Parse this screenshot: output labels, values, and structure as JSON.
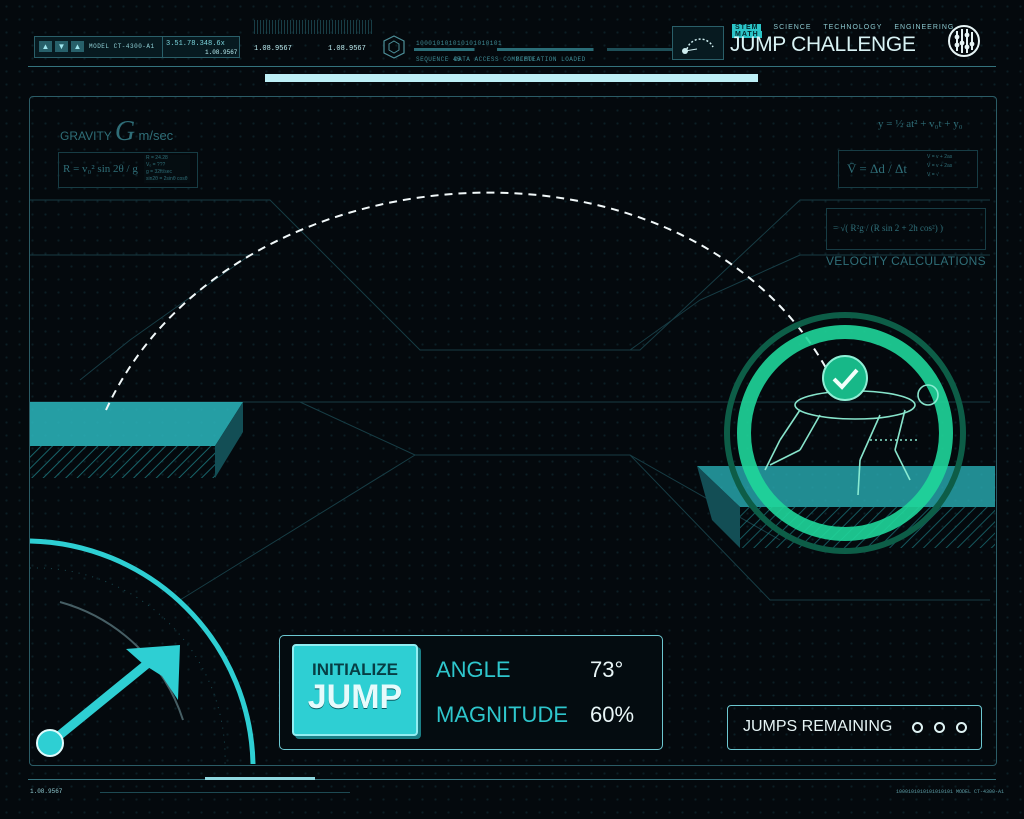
{
  "header": {
    "model_label": "MODEL CT-4300-A1",
    "readout_main": "3.51.78.348.6x",
    "readout_sub": "1.08.9567",
    "readout_a": "1.08.9567",
    "readout_b": "1.08.9567",
    "binary": "100010101010101010101",
    "sequence_label": "SEQUENCE 45",
    "data_label": "DATA ACCESS COMPLETE",
    "sim_label": "SIMULATION LOADED",
    "stem_tag": "STEM",
    "subjects": [
      "SCIENCE",
      "TECHNOLOGY",
      "ENGINEERING"
    ],
    "math_tag": "MATH",
    "title": "JUMP CHALLENGE"
  },
  "progress": {
    "fraction": 1.0
  },
  "formulas": {
    "gravity_label": "GRAVITY",
    "gravity_symbol": "G",
    "gravity_unit": "m/sec",
    "range_eq": "R = v₀² sin 2θ / g",
    "range_notes": [
      "R = 24.28",
      "Vₒ = ???",
      "g = 32ft/sec",
      "sin2θ = 2sinθ cosθ"
    ],
    "position_eq": "y = ½ at² + v₀t + y₀",
    "velocity_eq": "V̄ = Δd / Δt",
    "velocity_notes": [
      "V = v + 2as",
      "V = v + 2as",
      "V = √"
    ],
    "root_eq": "= √( R²g / (R sin 2 + 2h cos²) )",
    "velocity_title": "VELOCITY CALCULATIONS"
  },
  "controls": {
    "button_line1": "INITIALIZE",
    "button_line2": "JUMP",
    "angle_label": "ANGLE",
    "angle_value": "73°",
    "magnitude_label": "MAGNITUDE",
    "magnitude_value": "60%"
  },
  "jumps": {
    "label": "JUMPS REMAINING",
    "count": 3
  },
  "footer": {
    "left_readout": "1.08.9567",
    "right_readout": "1000101010101010101 MODEL CT-4300-A1"
  },
  "colors": {
    "accent": "#2ecfd3",
    "success": "#1fd69a",
    "panel_line": "#2b5c66"
  }
}
